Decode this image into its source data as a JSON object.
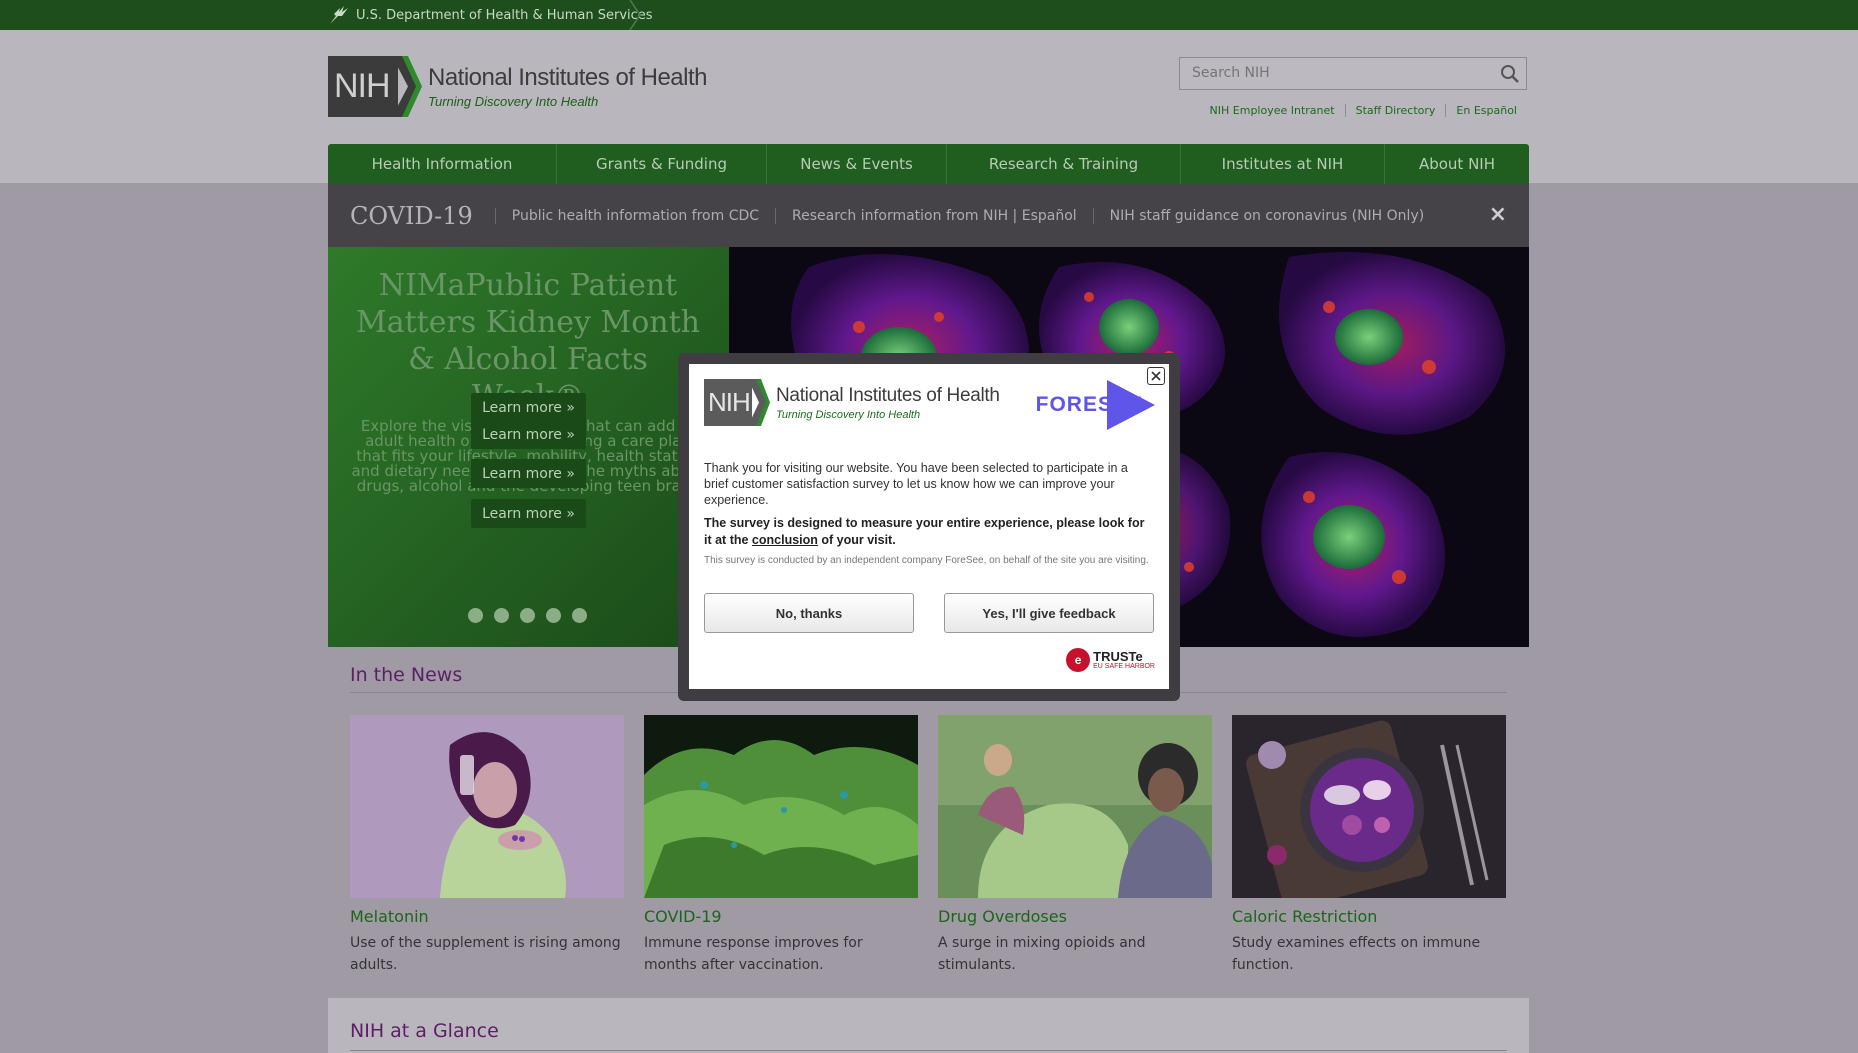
{
  "top_bar": {
    "hhs_label": "U.S. Department of Health & Human Services"
  },
  "header": {
    "logo_abbr": "NIH",
    "logo_title": "National Institutes of Health",
    "logo_tagline": "Turning Discovery Into Health",
    "search_placeholder": "Search NIH",
    "utility_links": [
      "NIH Employee Intranet",
      "Staff Directory",
      "En Español"
    ]
  },
  "nav": {
    "items": [
      "Health Information",
      "Grants & Funding",
      "News & Events",
      "Research & Training",
      "Institutes at NIH",
      "About NIH"
    ]
  },
  "covid_bar": {
    "title": "COVID-19",
    "links": [
      "Public health information from CDC",
      "Research information from NIH | Español",
      "NIH staff guidance on coronavirus (NIH Only)"
    ],
    "close": "×"
  },
  "hero": {
    "title_overlap": "NIMaPublic Patient Matters Kidney Month & Alcohol Facts Week®",
    "sub_overlap": "Explore the vision of science that can add to adult health outcomes by using a care plan that fits your lifestyle, mobility, health status, and dietary needs. Shattering the myths about drugs, alcohol and the developing teen brain.",
    "learn_more": "Learn more »",
    "slide_count": 5
  },
  "in_the_news": {
    "heading": "In the News",
    "cards": [
      {
        "title": "Melatonin",
        "desc": "Use of the supplement is rising among adults."
      },
      {
        "title": "COVID-19",
        "desc": "Immune response improves for months after vaccination."
      },
      {
        "title": "Drug Overdoses",
        "desc": "A surge in mixing opioids and stimulants."
      },
      {
        "title": "Caloric Restriction",
        "desc": "Study examines effects on immune function."
      }
    ]
  },
  "at_a_glance": {
    "heading": "NIH at a Glance"
  },
  "survey_modal": {
    "logo_abbr": "NIH",
    "logo_title": "National Institutes of Health",
    "logo_tagline": "Turning Discovery Into Health",
    "brand": "FORESEE",
    "intro": "Thank you for visiting our website. You have been selected to participate in a brief customer satisfaction survey to let us know how we can improve your experience.",
    "emphasis_before": "The survey is designed to measure your entire experience, please look for it at the ",
    "emphasis_link": "conclusion",
    "emphasis_after": " of your visit.",
    "disclaimer": "This survey is conducted by an independent company ForeSee, on behalf of the site you are visiting.",
    "no_button": "No, thanks",
    "yes_button": "Yes, I'll give feedback",
    "truste_title": "TRUSTe",
    "truste_sub": "EU SAFE HARBOR"
  },
  "colors": {
    "brand_green": "#1f5e1e",
    "accent_purple": "#5c1f67",
    "link_green": "#1a671a"
  }
}
